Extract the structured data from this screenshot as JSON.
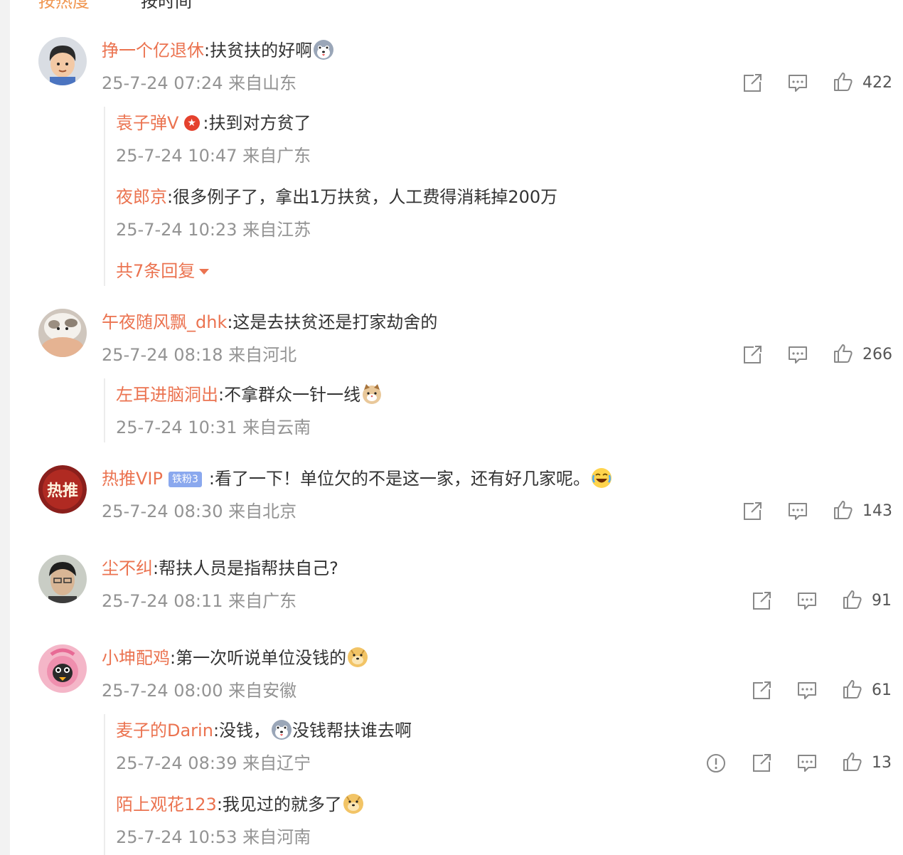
{
  "sort_tabs": {
    "hot": "按热度",
    "time": "按时间"
  },
  "icons": {
    "share": "share-icon",
    "comment": "comment-icon",
    "like": "like-icon",
    "report": "report-icon"
  },
  "colors": {
    "username": "#eb7350",
    "meta": "#939393",
    "text": "#333333",
    "sort_active": "#f09650"
  },
  "comments": [
    {
      "user": "挣一个亿退休",
      "text": ":扶贫扶的好啊",
      "emoji": "husky-emoji",
      "meta": "25-7-24 07:24 来自山东",
      "likes": "422",
      "replies": [
        {
          "user": "袁子弹V",
          "badge": "verified-badge",
          "text": ":扶到对方贫了",
          "meta": "25-7-24 10:47 来自广东"
        },
        {
          "user": "夜郎京",
          "text": ":很多例子了，拿出1万扶贫，人工费得消耗掉200万",
          "meta": "25-7-24 10:23 来自江苏"
        }
      ],
      "more_replies": "共7条回复"
    },
    {
      "user": "午夜随风飘_dhk",
      "text": ":这是去扶贫还是打家劫舍的",
      "meta": "25-7-24 08:18 来自河北",
      "likes": "266",
      "replies": [
        {
          "user": "左耳进脑洞出",
          "text": ":不拿群众一针一线",
          "emoji": "cat-emoji",
          "meta": "25-7-24 10:31 来自云南"
        }
      ]
    },
    {
      "user": "热推VIP",
      "fan_badge": "铁粉3",
      "text": ":看了一下！单位欠的不是这一家，还有好几家呢。",
      "emoji": "laugh-cry-emoji",
      "meta": "25-7-24 08:30 来自北京",
      "likes": "143",
      "avatar_text": "热推"
    },
    {
      "user": "尘不纠",
      "text": ":帮扶人员是指帮扶自己?",
      "meta": "25-7-24 08:11 来自广东",
      "likes": "91"
    },
    {
      "user": "小坤配鸡",
      "text": ":第一次听说单位没钱的",
      "emoji": "doge-emoji",
      "meta": "25-7-24 08:00 来自安徽",
      "likes": "61",
      "replies": [
        {
          "user": "麦子的Darin",
          "text": ":没钱，",
          "text2": "没钱帮扶谁去啊",
          "emoji": "husky-emoji",
          "meta": "25-7-24 08:39 来自辽宁",
          "likes": "13"
        },
        {
          "user": "陌上观花123",
          "text": ":我见过的就多了",
          "emoji": "doge-emoji",
          "meta": "25-7-24 10:53 来自河南"
        }
      ]
    }
  ]
}
